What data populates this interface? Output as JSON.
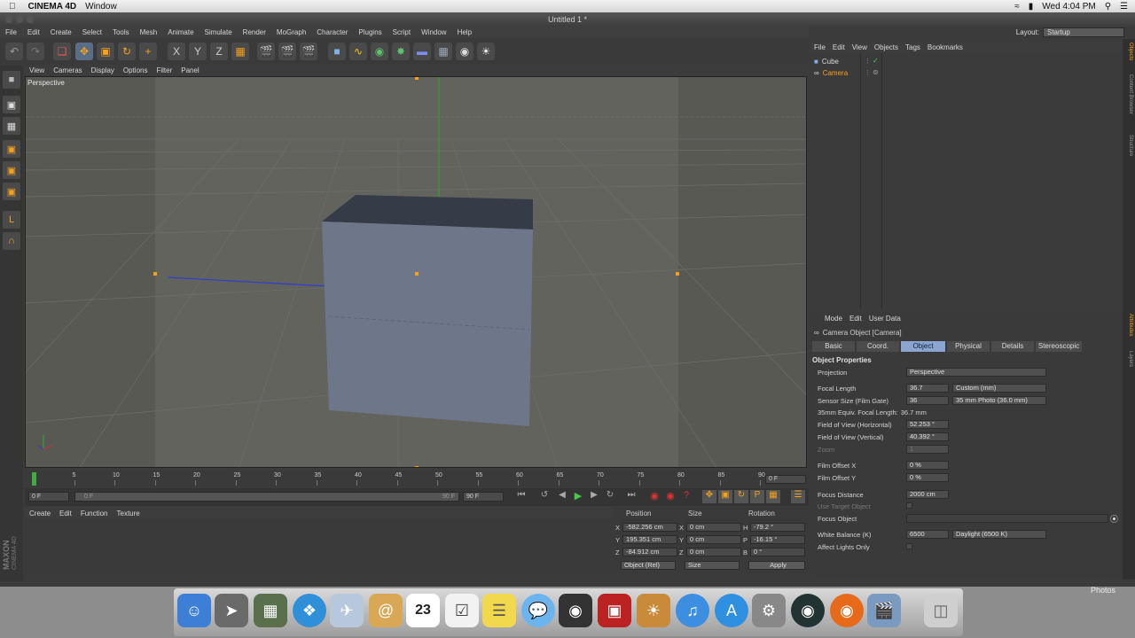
{
  "menubar": {
    "app": "CINEMA 4D",
    "items": [
      "Window"
    ],
    "clock": "Wed 4:04 PM"
  },
  "window": {
    "title": "Untitled 1 *"
  },
  "c4d_menu": [
    "File",
    "Edit",
    "Create",
    "Select",
    "Tools",
    "Mesh",
    "Animate",
    "Simulate",
    "Render",
    "MoGraph",
    "Character",
    "Plugins",
    "Script",
    "Window",
    "Help"
  ],
  "layout": {
    "label": "Layout:",
    "value": "Startup"
  },
  "viewport": {
    "menu": [
      "View",
      "Cameras",
      "Display",
      "Options",
      "Filter",
      "Panel"
    ],
    "label": "Perspective"
  },
  "timeline": {
    "ticks": [
      "0",
      "5",
      "10",
      "15",
      "20",
      "25",
      "30",
      "35",
      "40",
      "45",
      "50",
      "55",
      "60",
      "65",
      "70",
      "75",
      "80",
      "85",
      "90"
    ],
    "end_field": "0 F",
    "start": "0 F",
    "slider_start": "0 F",
    "slider_end": "90 F",
    "end": "90 F"
  },
  "material": {
    "menu": [
      "Create",
      "Edit",
      "Function",
      "Texture"
    ],
    "brand1": "MAXON",
    "brand2": "CINEMA 4D"
  },
  "coords": {
    "headers": [
      "Position",
      "Size",
      "Rotation"
    ],
    "rows": [
      {
        "axis": "X",
        "pos": "-582.256 cm",
        "size_axis": "X",
        "size": "0 cm",
        "rot_axis": "H",
        "rot": "-79.2 °"
      },
      {
        "axis": "Y",
        "pos": "195.351 cm",
        "size_axis": "Y",
        "size": "0 cm",
        "rot_axis": "P",
        "rot": "-16.15 °"
      },
      {
        "axis": "Z",
        "pos": "-84.912 cm",
        "size_axis": "Z",
        "size": "0 cm",
        "rot_axis": "B",
        "rot": "0 °"
      }
    ],
    "mode": "Object (Rel)",
    "size_mode": "Size",
    "apply": "Apply"
  },
  "objects": {
    "menu": [
      "File",
      "Edit",
      "View",
      "Objects",
      "Tags",
      "Bookmarks"
    ],
    "items": [
      {
        "name": "Cube",
        "color": "#d8d8d8"
      },
      {
        "name": "Camera",
        "color": "#f6a11b"
      }
    ]
  },
  "attributes": {
    "menu": [
      "Mode",
      "Edit",
      "User Data"
    ],
    "title": "Camera Object [Camera]",
    "tabs": [
      "Basic",
      "Coord.",
      "Object",
      "Physical",
      "Details",
      "Stereoscopic"
    ],
    "active_tab": "Object",
    "section": "Object Properties",
    "projection_label": "Projection",
    "projection": "Perspective",
    "focal_length_label": "Focal Length",
    "focal_length": "36.7",
    "focal_preset": "Custom (mm)",
    "sensor_label": "Sensor Size (Film Gate)",
    "sensor": "36",
    "sensor_preset": "35 mm Photo (36.0 mm)",
    "equiv_label": "35mm Equiv. Focal Length:",
    "equiv": "36.7 mm",
    "fovh_label": "Field of View (Horizontal)",
    "fovh": "52.253 °",
    "fovv_label": "Field of View (Vertical)",
    "fovv": "40.392 °",
    "zoom_label": "Zoom",
    "zoom": "1",
    "filmx_label": "Film Offset X",
    "filmx": "0 %",
    "filmy_label": "Film Offset Y",
    "filmy": "0 %",
    "focus_label": "Focus Distance",
    "focus": "2000 cm",
    "use_target_label": "Use Target Object",
    "focus_obj_label": "Focus Object",
    "wb_label": "White Balance (K)",
    "wb": "6500",
    "wb_preset": "Daylight (6500 K)",
    "affect_label": "Affect Lights Only"
  },
  "right_strip": [
    "Objects",
    "Content Browser",
    "Structure",
    "Attributes",
    "Layers"
  ],
  "dock": {
    "label": "Photos",
    "calendar_day": "23"
  }
}
